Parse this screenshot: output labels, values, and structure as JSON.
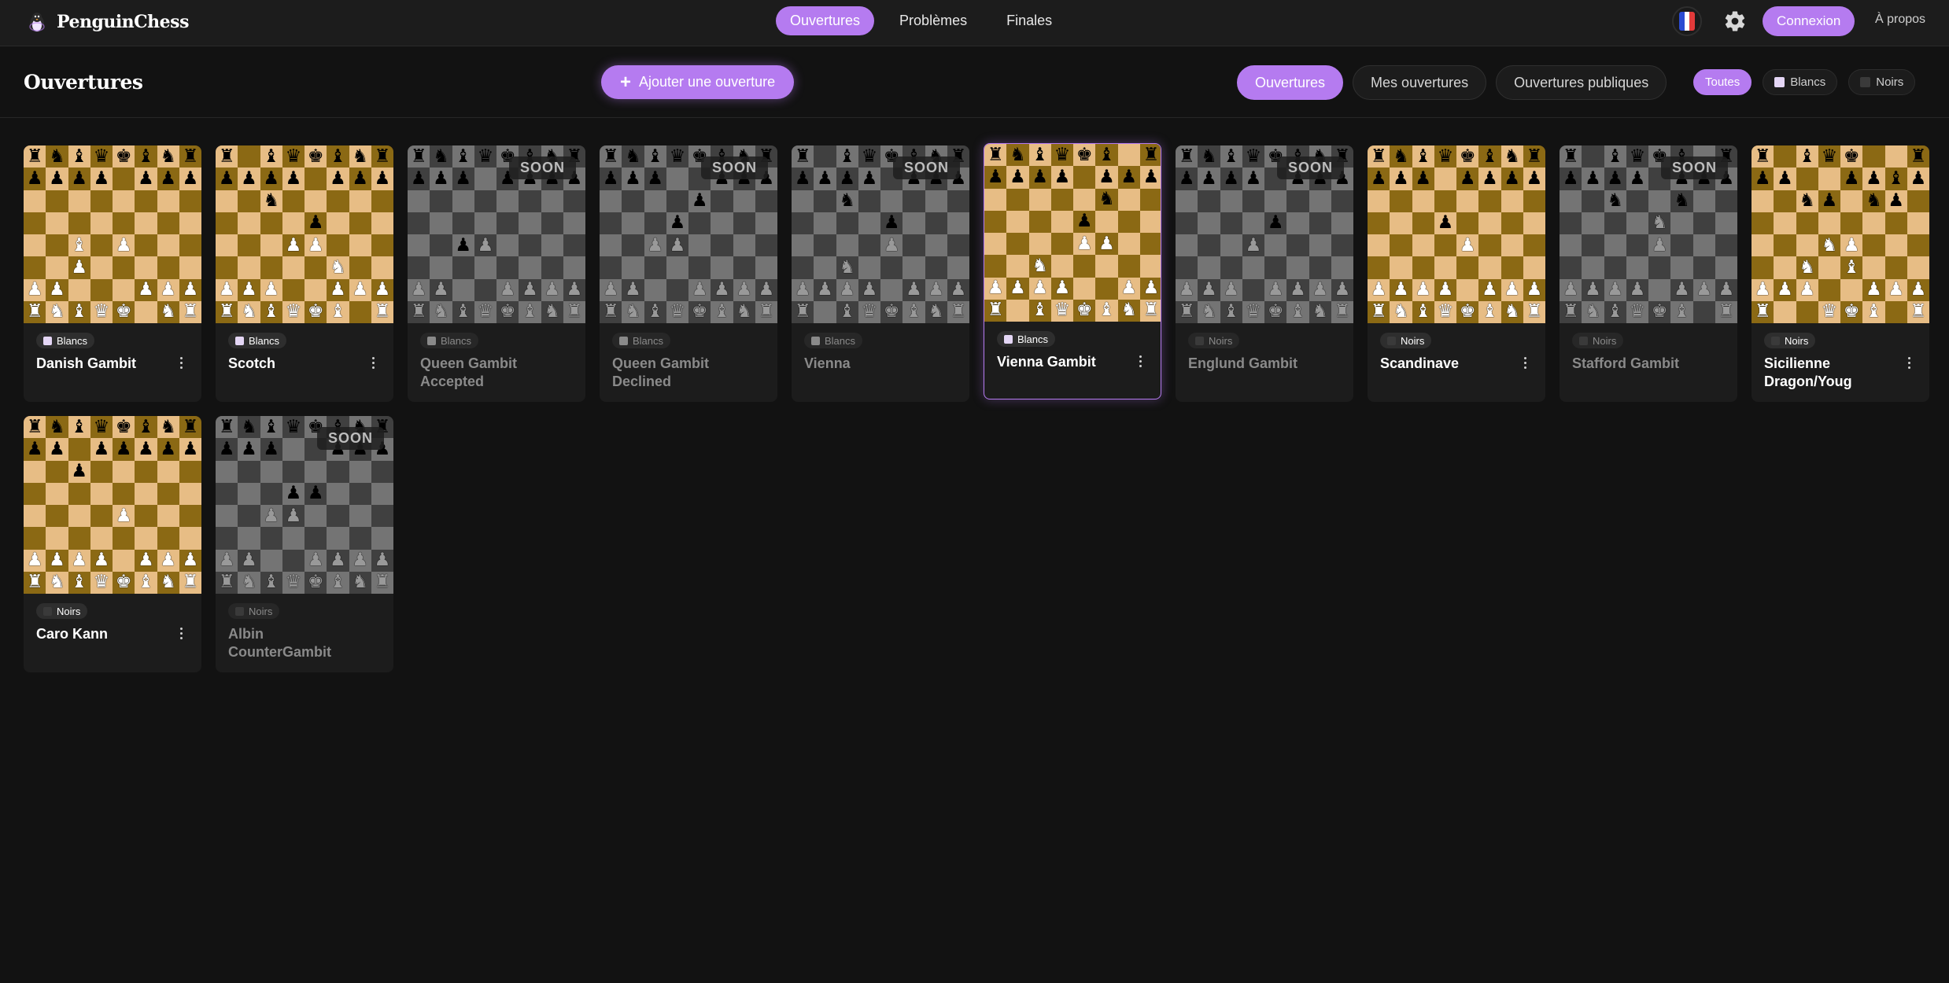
{
  "app": {
    "name": "PenguinChess"
  },
  "nav": {
    "items": [
      {
        "label": "Ouvertures",
        "active": true
      },
      {
        "label": "Problèmes",
        "active": false
      },
      {
        "label": "Finales",
        "active": false
      }
    ]
  },
  "header": {
    "login_label": "Connexion",
    "about_label": "À propos",
    "language_flag": "french-flag-icon",
    "settings_icon": "gear-icon"
  },
  "page": {
    "title": "Ouvertures",
    "add_label": "Ajouter une ouverture",
    "filters": [
      {
        "label": "Ouvertures",
        "active": true
      },
      {
        "label": "Mes ouvertures",
        "active": false
      },
      {
        "label": "Ouvertures publiques",
        "active": false
      }
    ],
    "color_filters": [
      {
        "label": "Toutes",
        "active": true,
        "swatch": ""
      },
      {
        "label": "Blancs",
        "active": false,
        "swatch": "#e4d6f5"
      },
      {
        "label": "Noirs",
        "active": false,
        "swatch": "#3a3a3a"
      }
    ]
  },
  "colors": {
    "accent": "#b57bf0",
    "board_light": "#e7bd85",
    "board_dark": "#8b6914",
    "background": "#121212"
  },
  "soon_label": "SOON",
  "openings": [
    {
      "name": "Danish Gambit",
      "side": "Blancs",
      "soon": false,
      "selected": false,
      "fen": "rnbqkbnr/pppp1ppp/8/8/2B1P3/2P5/PP3PPP/RNBQK1NR"
    },
    {
      "name": "Scotch",
      "side": "Blancs",
      "soon": false,
      "selected": false,
      "fen": "r1bqkbnr/pppp1ppp/2n5/4p3/3PP3/5N2/PPP2PPP/RNBQKB1R"
    },
    {
      "name": "Queen Gambit Accepted",
      "side": "Blancs",
      "soon": true,
      "selected": false,
      "fen": "rnbqkbnr/ppp1pppp/8/8/2pP4/8/PP2PPPP/RNBQKBNR"
    },
    {
      "name": "Queen Gambit Declined",
      "side": "Blancs",
      "soon": true,
      "selected": false,
      "fen": "rnbqkbnr/ppp2ppp/4p3/3p4/2PP4/8/PP2PPPP/RNBQKBNR"
    },
    {
      "name": "Vienna",
      "side": "Blancs",
      "soon": true,
      "selected": false,
      "fen": "r1bqkbnr/pppp1ppp/2n5/4p3/4P3/2N5/PPPP1PPP/R1BQKBNR"
    },
    {
      "name": "Vienna Gambit",
      "side": "Blancs",
      "soon": false,
      "selected": true,
      "fen": "rnbqkb1r/pppp1ppp/5n2/4p3/4PP2/2N5/PPPP2PP/R1BQKBNR"
    },
    {
      "name": "Englund Gambit",
      "side": "Noirs",
      "soon": true,
      "selected": false,
      "fen": "rnbqkbnr/pppp1ppp/8/4p3/3P4/8/PPP1PPPP/RNBQKBNR"
    },
    {
      "name": "Scandinave",
      "side": "Noirs",
      "soon": false,
      "selected": false,
      "fen": "rnbqkbnr/ppp1pppp/8/3p4/4P3/8/PPPP1PPP/RNBQKBNR"
    },
    {
      "name": "Stafford Gambit",
      "side": "Noirs",
      "soon": true,
      "selected": false,
      "fen": "r1bqkb1r/pppp1ppp/2n2n2/4N3/4P3/8/PPPP1PPP/RNBQKB1R"
    },
    {
      "name": "Sicilienne Dragon/Youg",
      "side": "Noirs",
      "soon": false,
      "selected": false,
      "fen": "r1bqk2r/pp2ppbp/2np1np1/8/3NP3/2N1B3/PPP2PPP/R2QKB1R"
    },
    {
      "name": "Caro Kann",
      "side": "Noirs",
      "soon": false,
      "selected": false,
      "fen": "rnbqkbnr/pp1ppppp/2p5/8/4P3/8/PPPP1PPP/RNBQKBNR"
    },
    {
      "name": "Albin CounterGambit",
      "side": "Noirs",
      "soon": true,
      "selected": false,
      "fen": "rnbqkbnr/ppp2ppp/8/3pp3/2PP4/8/PP2PPPP/RNBQKBNR"
    }
  ]
}
